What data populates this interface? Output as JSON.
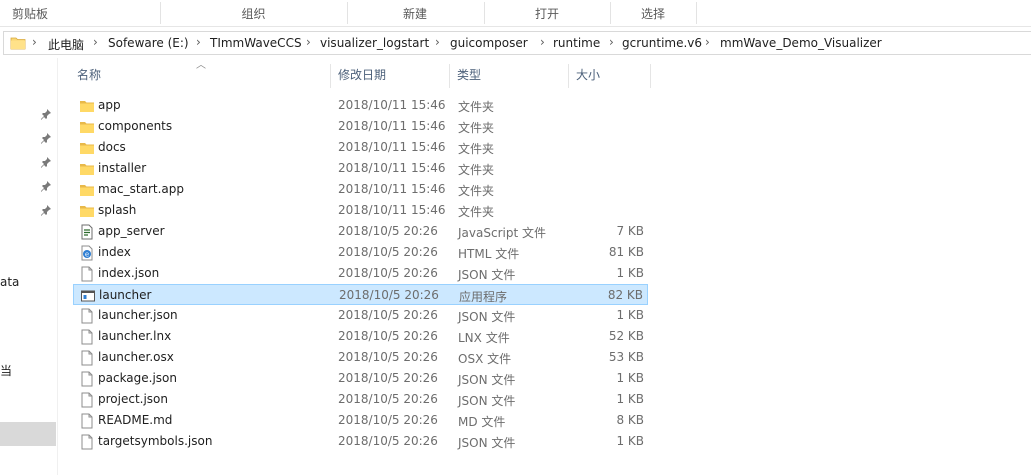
{
  "ribbon": {
    "groups": [
      "剪贴板",
      "组织",
      "新建",
      "打开",
      "选择"
    ]
  },
  "address": {
    "crumbs": [
      "此电脑",
      "Sofeware (E:)",
      "TImmWaveCCS",
      "visualizer_logstart",
      "guicomposer",
      "runtime",
      "gcruntime.v6",
      "mmWave_Demo_Visualizer"
    ]
  },
  "nav": {
    "fragments": [
      "ata",
      "当"
    ]
  },
  "columns": {
    "name": "名称",
    "date": "修改日期",
    "type": "类型",
    "size": "大小"
  },
  "files": [
    {
      "name": "app",
      "date": "2018/10/11 15:46",
      "type": "文件夹",
      "size": "",
      "icon": "folder-icon"
    },
    {
      "name": "components",
      "date": "2018/10/11 15:46",
      "type": "文件夹",
      "size": "",
      "icon": "folder-icon"
    },
    {
      "name": "docs",
      "date": "2018/10/11 15:46",
      "type": "文件夹",
      "size": "",
      "icon": "folder-icon"
    },
    {
      "name": "installer",
      "date": "2018/10/11 15:46",
      "type": "文件夹",
      "size": "",
      "icon": "folder-icon"
    },
    {
      "name": "mac_start.app",
      "date": "2018/10/11 15:46",
      "type": "文件夹",
      "size": "",
      "icon": "folder-icon"
    },
    {
      "name": "splash",
      "date": "2018/10/11 15:46",
      "type": "文件夹",
      "size": "",
      "icon": "folder-icon"
    },
    {
      "name": "app_server",
      "date": "2018/10/5 20:26",
      "type": "JavaScript 文件",
      "size": "7 KB",
      "icon": "script-file-icon"
    },
    {
      "name": "index",
      "date": "2018/10/5 20:26",
      "type": "HTML 文件",
      "size": "81 KB",
      "icon": "html-file-icon"
    },
    {
      "name": "index.json",
      "date": "2018/10/5 20:26",
      "type": "JSON 文件",
      "size": "1 KB",
      "icon": "file-icon"
    },
    {
      "name": "launcher",
      "date": "2018/10/5 20:26",
      "type": "应用程序",
      "size": "82 KB",
      "icon": "app-icon",
      "selected": true
    },
    {
      "name": "launcher.json",
      "date": "2018/10/5 20:26",
      "type": "JSON 文件",
      "size": "1 KB",
      "icon": "file-icon"
    },
    {
      "name": "launcher.lnx",
      "date": "2018/10/5 20:26",
      "type": "LNX 文件",
      "size": "52 KB",
      "icon": "file-icon"
    },
    {
      "name": "launcher.osx",
      "date": "2018/10/5 20:26",
      "type": "OSX 文件",
      "size": "53 KB",
      "icon": "file-icon"
    },
    {
      "name": "package.json",
      "date": "2018/10/5 20:26",
      "type": "JSON 文件",
      "size": "1 KB",
      "icon": "file-icon"
    },
    {
      "name": "project.json",
      "date": "2018/10/5 20:26",
      "type": "JSON 文件",
      "size": "1 KB",
      "icon": "file-icon"
    },
    {
      "name": "README.md",
      "date": "2018/10/5 20:26",
      "type": "MD 文件",
      "size": "8 KB",
      "icon": "file-icon"
    },
    {
      "name": "targetsymbols.json",
      "date": "2018/10/5 20:26",
      "type": "JSON 文件",
      "size": "1 KB",
      "icon": "file-icon"
    }
  ]
}
